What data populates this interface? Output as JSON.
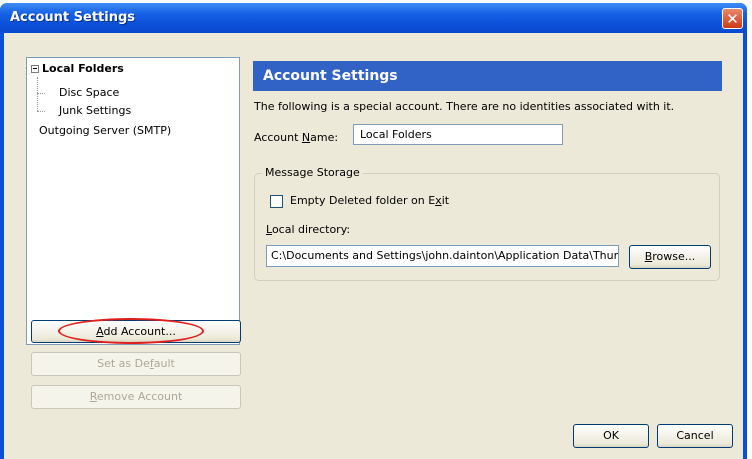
{
  "window": {
    "title": "Account Settings",
    "close_glyph": "✕"
  },
  "tree": {
    "root": "Local Folders",
    "children": [
      "Disc Space",
      "Junk Settings"
    ],
    "items": [
      "Outgoing Server (SMTP)"
    ]
  },
  "left_buttons": {
    "add_account": {
      "pre": "",
      "key": "A",
      "post": "dd Account..."
    },
    "set_default": {
      "pre": "Set as De",
      "key": "f",
      "post": "ault"
    },
    "remove_account": {
      "pre": "",
      "key": "R",
      "post": "emove Account"
    }
  },
  "panel": {
    "header": "Account Settings",
    "note": "The following is a special account. There are no identities associated with it.",
    "account_name": {
      "pre": "Account ",
      "key": "N",
      "post": "ame:",
      "value": "Local Folders"
    },
    "storage_legend": "Message Storage",
    "empty_deleted": {
      "pre": "Empty Deleted folder on E",
      "key": "x",
      "post": "it",
      "checked": false
    },
    "local_dir": {
      "pre": "",
      "key": "L",
      "post": "ocal directory:",
      "value": "C:\\Documents and Settings\\john.dainton\\Application Data\\Thunderbird"
    },
    "browse": {
      "pre": "",
      "key": "B",
      "post": "rowse..."
    }
  },
  "dialog_buttons": {
    "ok": "OK",
    "cancel": "Cancel"
  },
  "colors": {
    "title_bar": "#0a50d8",
    "header_bg": "#3163c6",
    "dialog_bg": "#ece9d8",
    "highlight_oval": "#e0201c"
  },
  "icons": {
    "expander": "minus-box-icon",
    "close": "close-icon"
  }
}
